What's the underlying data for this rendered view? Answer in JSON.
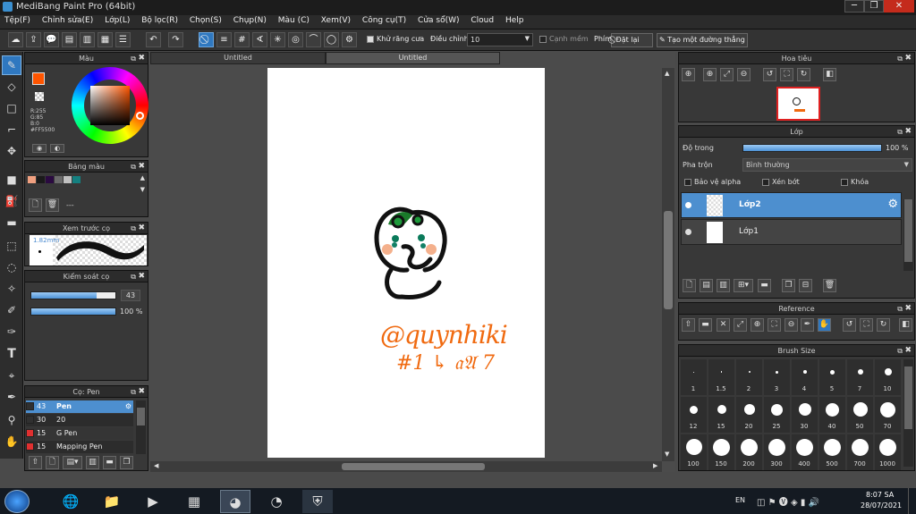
{
  "window": {
    "title": "MediBang Paint Pro (64bit)",
    "min": "─",
    "max": "❐",
    "close": "✕"
  },
  "menu": [
    "Tệp(F)",
    "Chỉnh sửa(E)",
    "Lớp(L)",
    "Bộ lọc(R)",
    "Chọn(S)",
    "Chụp(N)",
    "Màu (C)",
    "Xem(V)",
    "Công cụ(T)",
    "Cửa sổ(W)",
    "Cloud",
    "Help"
  ],
  "toolbar": {
    "antialias_label": "Khử răng cưa",
    "adjust_label": "Điều chỉnh",
    "adjust_value": "10",
    "margin_label": "Cạnh mềm",
    "key_label": "Phím",
    "reset_label": "Đặt lại",
    "line_label": "Tạo một đường thẳng"
  },
  "tabs": {
    "tab1": "Untitled",
    "tab2": "Untitled"
  },
  "color_panel": {
    "title": "Màu",
    "r": "R:255",
    "g": "G:85",
    "b": "B:0",
    "hex": "#FF5500",
    "primary_color": "#ff5500"
  },
  "palette_panel": {
    "title": "Bảng màu",
    "swatches": [
      "#f0a080",
      "#1a1a1a",
      "#2a0a40",
      "#6a6a6a",
      "#c0c0c0",
      "#158080"
    ],
    "dash": "---"
  },
  "preview_panel": {
    "title": "Xem trước cọ",
    "size": "1.82mm"
  },
  "brush_control": {
    "title": "Kiểm soát cọ",
    "size": "43",
    "opacity": "100",
    "opacity_unit": "%",
    "size_fill": 0.78,
    "opacity_fill": 1.0
  },
  "brush_list": {
    "title": "Cọ: Pen",
    "items": [
      {
        "size": "43",
        "name": "Pen",
        "color": "#303030"
      },
      {
        "size": "30",
        "name": "20",
        "color": "#303030"
      },
      {
        "size": "15",
        "name": "G Pen",
        "color": "#e03030"
      },
      {
        "size": "15",
        "name": "Mapping Pen",
        "color": "#e03030"
      }
    ]
  },
  "artwork": {
    "signature": "@quynhiki",
    "tag": "#1 ↳ 𝔞𝔄 7"
  },
  "navigator": {
    "title": "Hoa tiêu"
  },
  "layer_panel": {
    "title": "Lớp",
    "opacity_label": "Độ trong",
    "opacity_value": "100 %",
    "opacity_fill": 1.0,
    "blend_label": "Pha trộn",
    "blend_value": "Bình thường",
    "alpha_label": "Bảo vệ alpha",
    "clip_label": "Xén bớt",
    "lock_label": "Khóa",
    "layers": [
      {
        "name": "Lớp2",
        "selected": true
      },
      {
        "name": "Lớp1",
        "selected": false
      }
    ]
  },
  "reference": {
    "title": "Reference"
  },
  "brush_size": {
    "title": "Brush Size",
    "labels": [
      "1",
      "1.5",
      "2",
      "3",
      "4",
      "5",
      "7",
      "10",
      "12",
      "15",
      "20",
      "25",
      "30",
      "40",
      "50",
      "70",
      "100",
      "150",
      "200",
      "300",
      "400",
      "500",
      "700",
      "1000"
    ]
  },
  "taskbar": {
    "lang": "EN",
    "time": "8:07 SA",
    "date": "28/07/2021"
  }
}
